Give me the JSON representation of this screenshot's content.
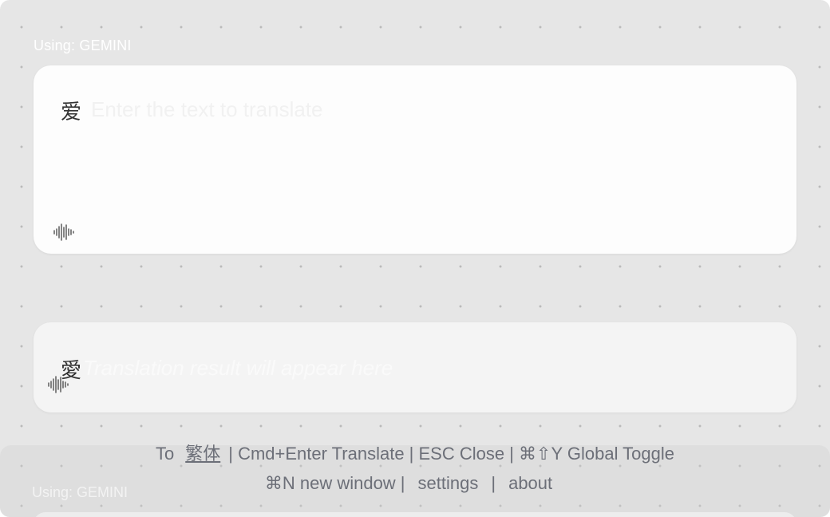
{
  "app": {
    "provider_label": "Using: GEMINI"
  },
  "input": {
    "text": "爱",
    "placeholder": "Enter the text to translate",
    "voice_icon": "audio-waveform-icon"
  },
  "output": {
    "text": "愛",
    "placeholder": "Translation result will appear here",
    "voice_icon": "audio-waveform-icon"
  },
  "footer": {
    "to_label": "To",
    "target_language": "繁体",
    "shortcuts_text": "| Cmd+Enter Translate | ESC Close | ⌘⇧Y Global Toggle",
    "new_window_text": "⌘N new window |",
    "settings_label": "settings",
    "separator": "|",
    "about_label": "about"
  },
  "background_window": {
    "provider_label": "Using: GEMINI"
  },
  "colors": {
    "background": "#e6e6e6",
    "card": "#fdfdfd",
    "output_card": "#f4f4f4",
    "footer_text": "#6c6f78",
    "text": "#333333"
  }
}
